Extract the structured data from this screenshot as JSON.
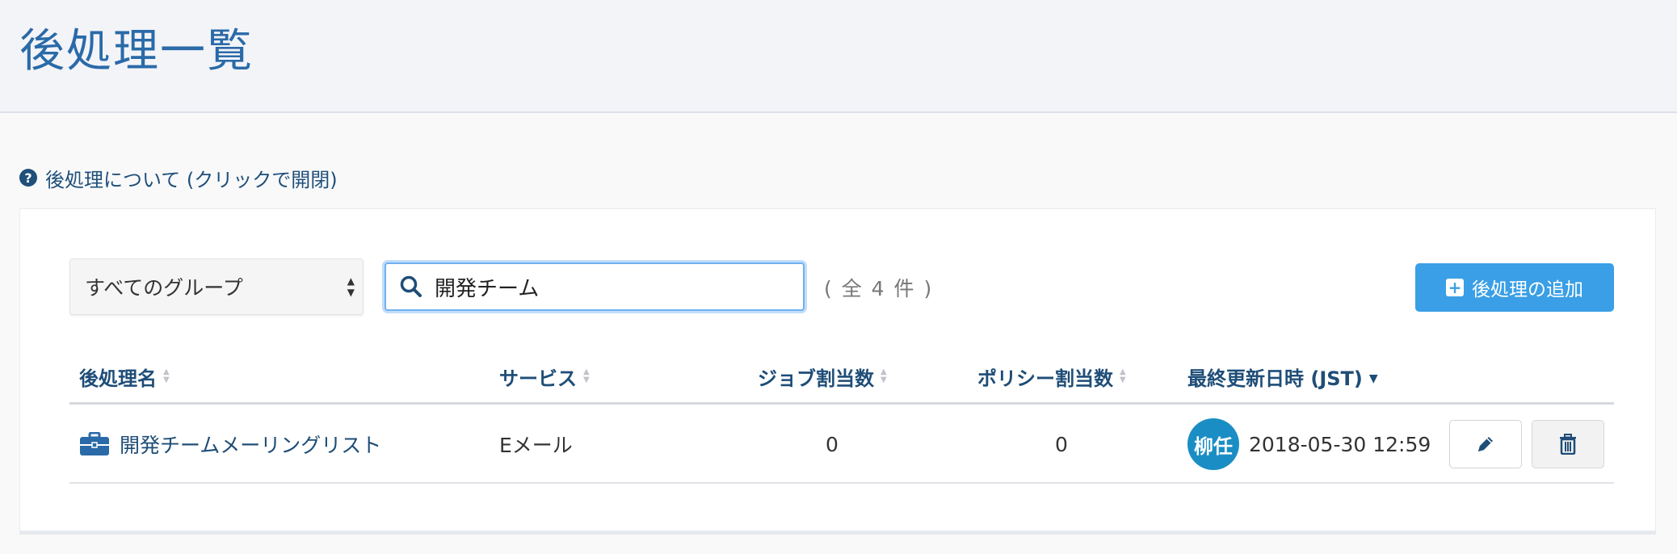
{
  "header": {
    "title": "後処理一覧"
  },
  "about": {
    "label": "後処理について (クリックで開閉)"
  },
  "filters": {
    "group_select": "すべてのグループ",
    "search_value": "開発チーム",
    "count": "( 全 4 件 )",
    "add_button": "後処理の追加"
  },
  "table": {
    "columns": [
      "後処理名",
      "サービス",
      "ジョブ割当数",
      "ポリシー割当数",
      "最終更新日時 (JST)"
    ],
    "rows": [
      {
        "name": "開発チームメーリングリスト",
        "service": "Eメール",
        "job_count": "0",
        "policy_count": "0",
        "avatar": "柳任",
        "updated": "2018-05-30 12:59"
      }
    ]
  },
  "colors": {
    "accent": "#3a9fe6",
    "heading": "#1e4d77",
    "title": "#2a6aa8",
    "avatar": "#1a8ec4"
  }
}
